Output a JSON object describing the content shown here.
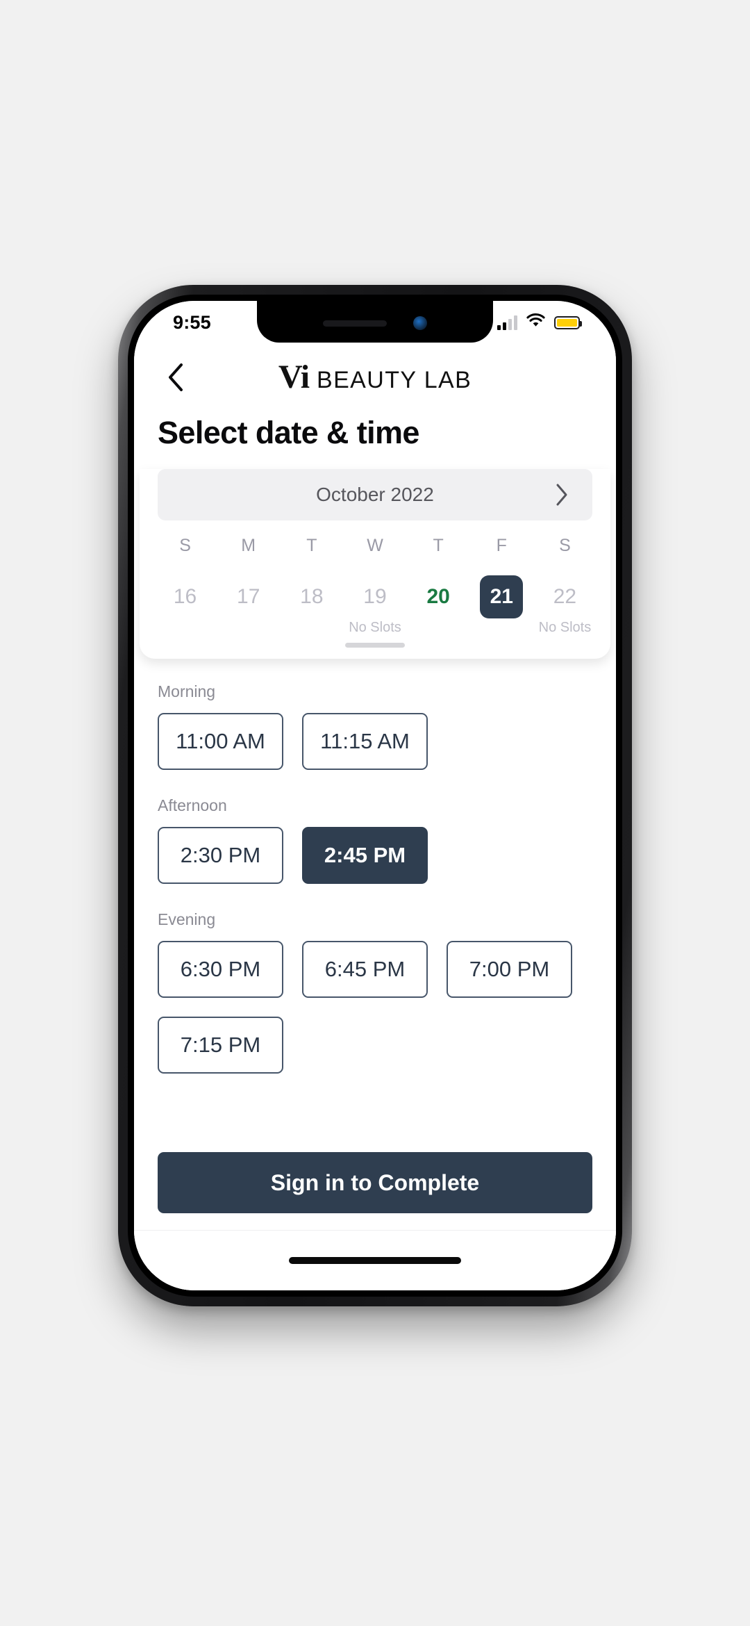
{
  "status_bar": {
    "time": "9:55",
    "signal_icon": "cellular-signal-icon",
    "signal_bars_filled": 2,
    "signal_bars_total": 4,
    "wifi_icon": "wifi-icon",
    "battery_icon": "battery-icon",
    "battery_color": "#fdcf09",
    "battery_level_percent": 100
  },
  "header": {
    "back_icon": "chevron-left-icon",
    "brand_mark": "Vi",
    "brand_name": "BEAUTY LAB"
  },
  "page": {
    "title": "Select date & time"
  },
  "calendar": {
    "month_label": "October 2022",
    "next_month_icon": "chevron-right-icon",
    "weekdays": [
      "S",
      "M",
      "T",
      "W",
      "T",
      "F",
      "S"
    ],
    "drag_handle": "calendar-drag-handle",
    "dates": [
      {
        "day": "16",
        "sub": "",
        "state": "muted"
      },
      {
        "day": "17",
        "sub": "",
        "state": "muted"
      },
      {
        "day": "18",
        "sub": "",
        "state": "muted"
      },
      {
        "day": "19",
        "sub": "No Slots",
        "state": "muted"
      },
      {
        "day": "20",
        "sub": "",
        "state": "available"
      },
      {
        "day": "21",
        "sub": "",
        "state": "selected"
      },
      {
        "day": "22",
        "sub": "No Slots",
        "state": "muted"
      }
    ]
  },
  "slots": {
    "groups": [
      {
        "label": "Morning",
        "times": [
          {
            "time": "11:00 AM",
            "selected": false
          },
          {
            "time": "11:15 AM",
            "selected": false
          }
        ]
      },
      {
        "label": "Afternoon",
        "times": [
          {
            "time": "2:30 PM",
            "selected": false
          },
          {
            "time": "2:45 PM",
            "selected": true
          }
        ]
      },
      {
        "label": "Evening",
        "times": [
          {
            "time": "6:30 PM",
            "selected": false
          },
          {
            "time": "6:45 PM",
            "selected": false
          },
          {
            "time": "7:00 PM",
            "selected": false
          },
          {
            "time": "7:15 PM",
            "selected": false
          }
        ]
      }
    ]
  },
  "footer": {
    "cta_label": "Sign in to Complete"
  },
  "colors": {
    "accent_navy": "#2f3e50",
    "available_green": "#1a7a42",
    "muted_gray": "#bdbdc6",
    "battery_yellow": "#fdcf09"
  }
}
